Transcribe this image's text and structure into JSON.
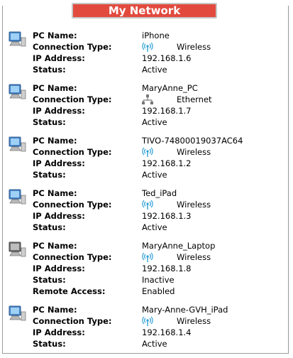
{
  "header": {
    "title": "My Network"
  },
  "labels": {
    "pc_name": "PC Name:",
    "connection_type": "Connection Type:",
    "ip_address": "IP Address:",
    "status": "Status:",
    "remote_access": "Remote Access:"
  },
  "devices": [
    {
      "name": "iPhone",
      "connection": "Wireless",
      "connection_icon": "wireless-icon",
      "ip": "192.168.1.6",
      "status": "Active",
      "icon": "computer-icon"
    },
    {
      "name": "MaryAnne_PC",
      "connection": "Ethernet",
      "connection_icon": "ethernet-icon",
      "ip": "192.168.1.7",
      "status": "Active",
      "icon": "computer-icon"
    },
    {
      "name": "TIVO-74800019037AC64",
      "connection": "Wireless",
      "connection_icon": "wireless-icon",
      "ip": "192.168.1.2",
      "status": "Active",
      "icon": "computer-icon"
    },
    {
      "name": "Ted_iPad",
      "connection": "Wireless",
      "connection_icon": "wireless-icon",
      "ip": "192.168.1.3",
      "status": "Active",
      "icon": "computer-icon"
    },
    {
      "name": "MaryAnne_Laptop",
      "connection": "Wireless",
      "connection_icon": "wireless-icon",
      "ip": "192.168.1.8",
      "status": "Inactive",
      "remote_access": "Enabled",
      "icon": "computer-inactive-icon"
    },
    {
      "name": "Mary-Anne-GVH_iPad",
      "connection": "Wireless",
      "connection_icon": "wireless-icon",
      "ip": "192.168.1.4",
      "status": "Active",
      "icon": "computer-icon"
    }
  ],
  "colors": {
    "header_bg": "#e24a3e",
    "header_border": "#c6c6c6",
    "wireless": "#2a9fd6",
    "monitor": "#3f7fc0"
  }
}
